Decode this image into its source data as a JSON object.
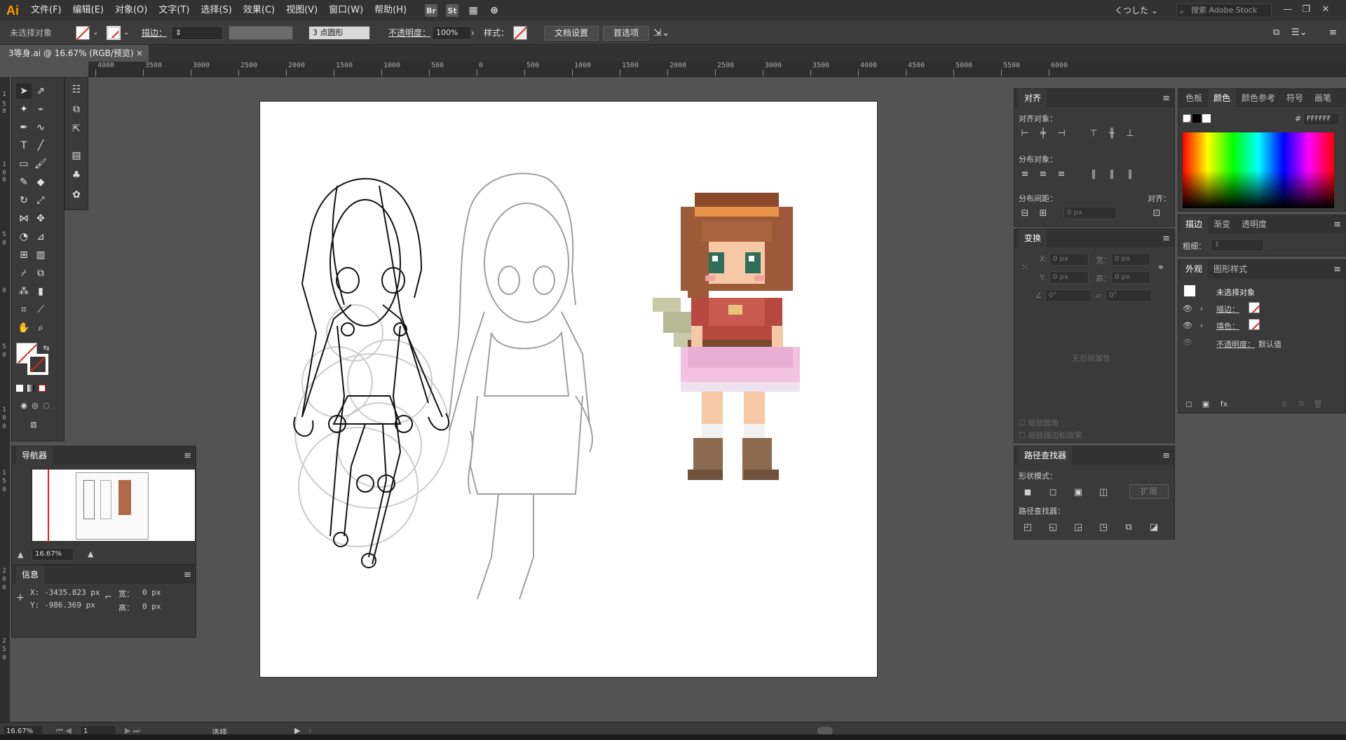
{
  "app": {
    "logo": "Ai"
  },
  "menu": [
    "文件(F)",
    "编辑(E)",
    "对象(O)",
    "文字(T)",
    "选择(S)",
    "效果(C)",
    "视图(V)",
    "窗口(W)",
    "帮助(H)"
  ],
  "menubar_icons": [
    "Br",
    "St"
  ],
  "workspace": "くつした",
  "stock_search": {
    "placeholder": "搜索 Adobe Stock"
  },
  "control_bar": {
    "selection_status": "未选择对象",
    "stroke_label": "描边：",
    "brush": "3 点圆形",
    "opacity_label": "不透明度：",
    "opacity_value": "100%",
    "style_label": "样式：",
    "doc_settings": "文档设置",
    "preferences": "首选项"
  },
  "document_tab": {
    "title": "3等身.ai @ 16.67% (RGB/预览)",
    "close": "×"
  },
  "ruler_ticks": [
    "4000",
    "3500",
    "3000",
    "2500",
    "2000",
    "1500",
    "1000",
    "500",
    "0",
    "500",
    "1000",
    "1500",
    "2000",
    "2500",
    "3000",
    "3500",
    "4000",
    "4500",
    "5000",
    "5500",
    "6000"
  ],
  "navigator": {
    "title": "导航器",
    "zoom": "16.67%"
  },
  "info": {
    "title": "信息",
    "x_label": "X:",
    "x_value": "-3435.823 px",
    "y_label": "Y:",
    "y_value": "-986.369 px",
    "w_label": "宽：",
    "w_value": "0 px",
    "h_label": "高：",
    "h_value": "0 px"
  },
  "align": {
    "title": "对齐",
    "align_objects": "对齐对象：",
    "distribute_objects": "分布对象：",
    "distribute_spacing": "分布间距：",
    "align_to": "对齐：",
    "spacing_value": "0 px"
  },
  "transform": {
    "title": "变换",
    "x": "X:",
    "y": "Y:",
    "w": "宽：",
    "h": "高：",
    "x_value": "0 px",
    "y_value": "0 px",
    "w_value": "0 px",
    "h_value": "0 px",
    "angle": "0°",
    "shear": "0°",
    "no_shape": "无形状属性",
    "scale_corners": "缩放圆角",
    "scale_strokes": "缩放描边和效果"
  },
  "pathfinder": {
    "title": "路径查找器",
    "shape_modes": "形状模式：",
    "expand": "扩展",
    "pathfinders": "路径查找器："
  },
  "color_panel": {
    "tabs": [
      "色板",
      "颜色",
      "颜色参考",
      "符号",
      "画笔"
    ],
    "hex": "FFFFFF"
  },
  "stroke_panel": {
    "tabs": [
      "描边",
      "渐变",
      "透明度"
    ],
    "weight_label": "粗细："
  },
  "appearance": {
    "tabs": [
      "外观",
      "图形样式"
    ],
    "header": "未选择对象",
    "stroke": "描边：",
    "fill": "填色：",
    "opacity_label": "不透明度：",
    "opacity_value": "默认值"
  },
  "status": {
    "zoom": "16.67%",
    "page": "1",
    "tool": "选择"
  }
}
